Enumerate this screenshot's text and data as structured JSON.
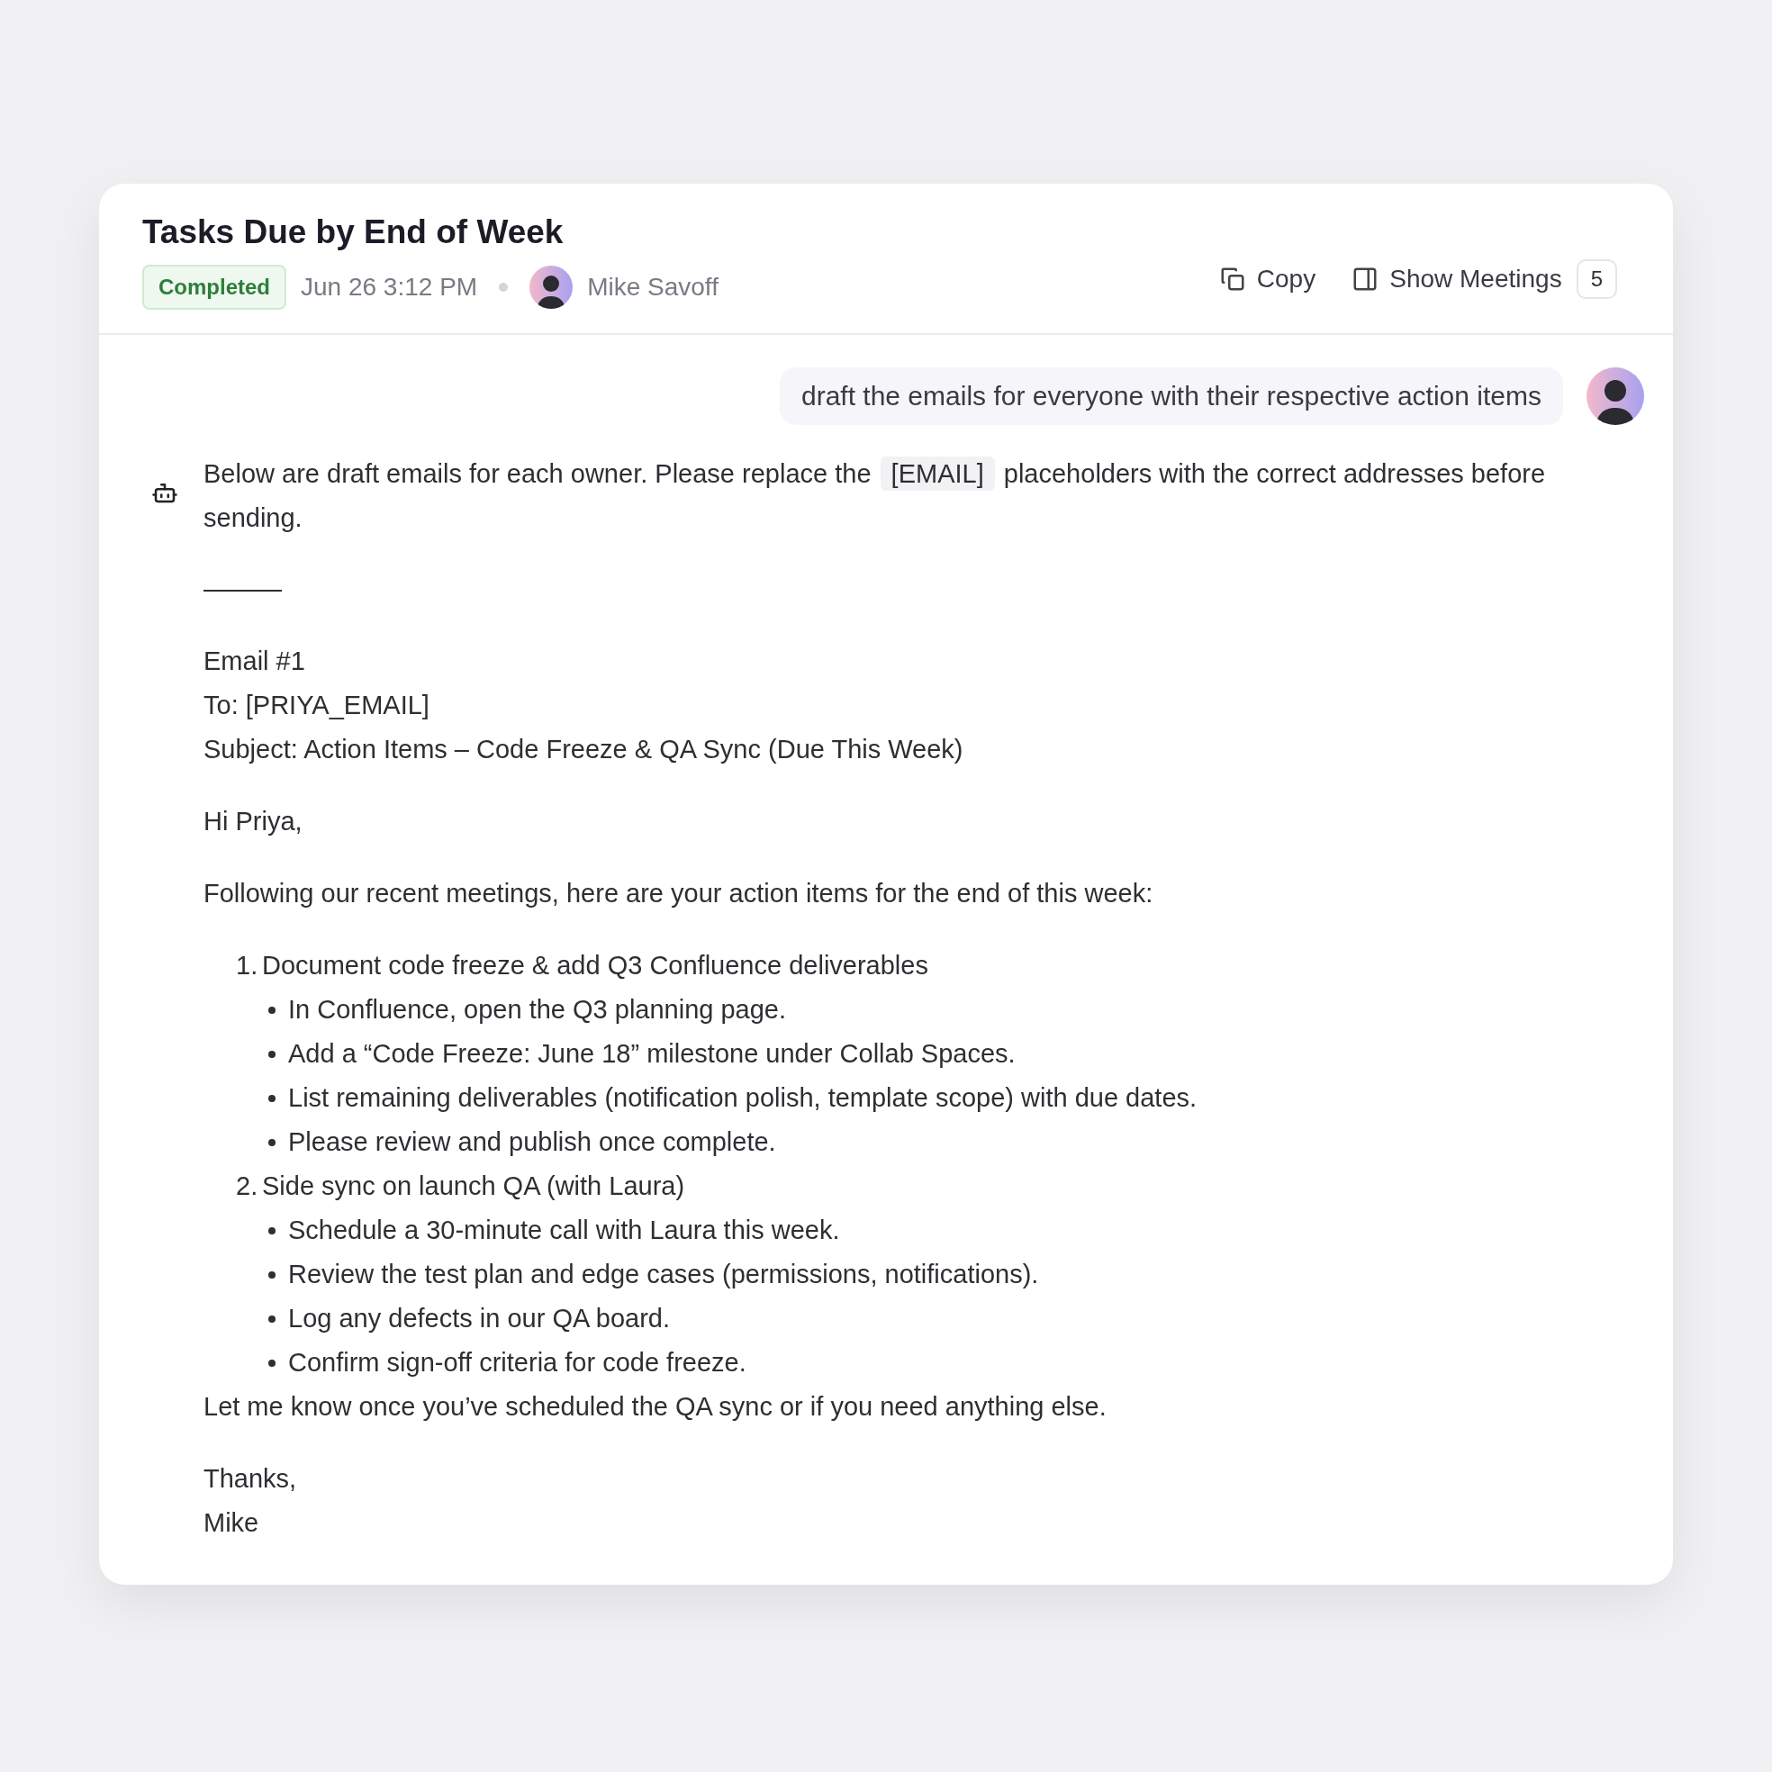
{
  "header": {
    "title": "Tasks Due by End of Week",
    "status": {
      "label": "Completed",
      "kind": "completed"
    },
    "timestamp": "Jun 26 3:12 PM",
    "author": "Mike Savoff",
    "actions": [
      {
        "kind": "copy",
        "label": "Copy"
      },
      {
        "kind": "panel",
        "label": "Show Meetings",
        "count": "5"
      }
    ]
  },
  "user_message": "draft the emails for everyone with their respective action items",
  "reply": {
    "intro": {
      "before": "Below are draft emails for each owner. Please replace the",
      "code": "[EMAIL]",
      "after": "placeholders with the correct addresses before sending."
    },
    "blocks": [
      {
        "kind": "rule",
        "text": "———"
      },
      {
        "kind": "lines",
        "lines": [
          "Email #1",
          "To: [PRIYA_EMAIL]",
          "Subject: Action Items – Code Freeze & QA Sync (Due This Week)"
        ]
      },
      {
        "kind": "lines",
        "lines": [
          "Hi Priya,"
        ]
      },
      {
        "kind": "lines",
        "lines": [
          "Following our recent meetings, here are your action items for the end of this week:"
        ]
      },
      {
        "kind": "list",
        "items": [
          {
            "number": "1.",
            "text": "Document code freeze & add Q3 Confluence deliverables",
            "bullets": [
              "In Confluence, open the Q3 planning page.",
              "Add a “Code Freeze: June 18” milestone under Collab Spaces.",
              "List remaining deliverables (notification polish, template scope) with due dates.",
              "Please review and publish once complete."
            ]
          },
          {
            "number": "2.",
            "text": "Side sync on launch QA (with Laura)",
            "bullets": [
              "Schedule a 30-minute call with Laura this week.",
              "Review the test plan and edge cases (permissions, notifications).",
              "Log any defects in our QA board.",
              "Confirm sign-off criteria for code freeze."
            ]
          }
        ]
      },
      {
        "kind": "tight",
        "lines": [
          "Let me know once you’ve scheduled the QA sync or if you need anything else."
        ]
      },
      {
        "kind": "lines",
        "lines": [
          "Thanks,",
          "Mike"
        ]
      }
    ]
  }
}
